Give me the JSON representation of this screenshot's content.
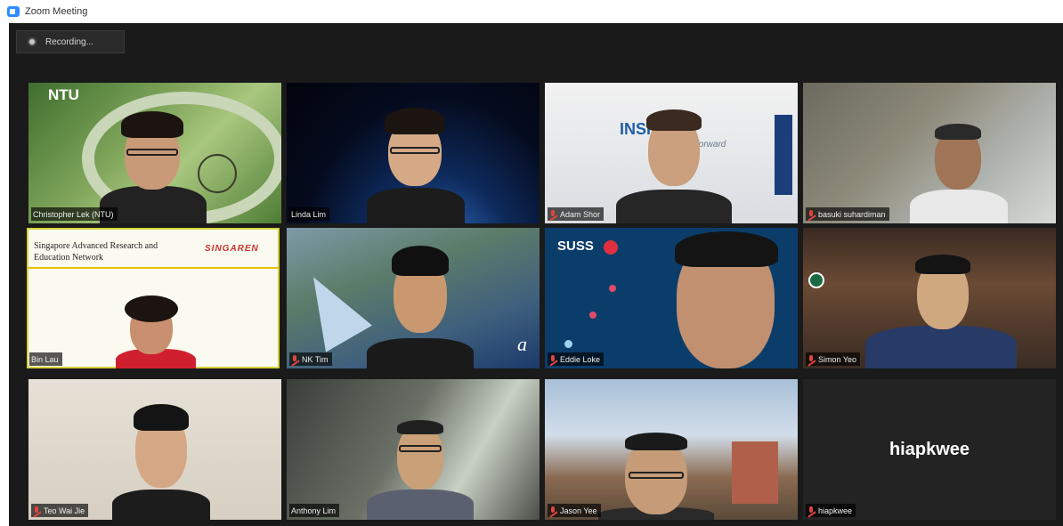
{
  "window": {
    "title": "Zoom Meeting"
  },
  "recording": {
    "label": "Recording..."
  },
  "logos": {
    "ntu": "NTU",
    "insights": "INSIGHTS",
    "insights_sub": "forward",
    "suss": "SUSS",
    "accent": "a"
  },
  "slide": {
    "line1": "Singapore Advanced Research and",
    "line2": "Education Network",
    "logo": "SINGAREN"
  },
  "participants": [
    {
      "name": "Christopher Lek (NTU)",
      "muted": false
    },
    {
      "name": "Linda Lim",
      "muted": false
    },
    {
      "name": "Adam Shor",
      "muted": true
    },
    {
      "name": "basuki suhardiman",
      "muted": true
    },
    {
      "name": "Bin Lau",
      "muted": false,
      "active": true
    },
    {
      "name": "NK Tim",
      "muted": true
    },
    {
      "name": "Eddie Loke",
      "muted": true
    },
    {
      "name": "Simon Yeo",
      "muted": true
    },
    {
      "name": "Teo Wai Jie",
      "muted": true
    },
    {
      "name": "Anthony Lim",
      "muted": false
    },
    {
      "name": "Jason Yee",
      "muted": true
    },
    {
      "name": "hiapkwee",
      "muted": true,
      "video_off": true,
      "display_name": "hiapkwee"
    }
  ],
  "colors": {
    "mute_red": "#e0443e",
    "active_border": "#d6d23a",
    "background": "#1a1a1a"
  }
}
